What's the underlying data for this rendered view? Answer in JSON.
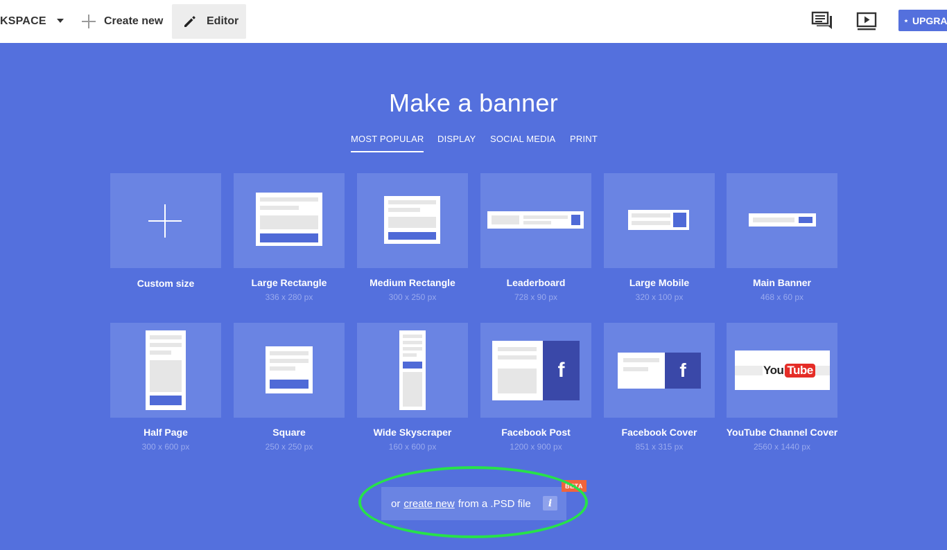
{
  "topbar": {
    "workspace_label": "KSPACE",
    "create_new_label": "Create new",
    "editor_label": "Editor",
    "upgrade_label": "UPGRADE"
  },
  "page": {
    "title": "Make a banner",
    "tabs": [
      {
        "label": "MOST POPULAR",
        "active": true
      },
      {
        "label": "DISPLAY",
        "active": false
      },
      {
        "label": "SOCIAL MEDIA",
        "active": false
      },
      {
        "label": "PRINT",
        "active": false
      }
    ]
  },
  "formats": [
    {
      "name": "Custom size",
      "size": ""
    },
    {
      "name": "Large Rectangle",
      "size": "336 x 280 px"
    },
    {
      "name": "Medium Rectangle",
      "size": "300 x 250 px"
    },
    {
      "name": "Leaderboard",
      "size": "728 x 90 px"
    },
    {
      "name": "Large Mobile",
      "size": "320 x 100 px"
    },
    {
      "name": "Main Banner",
      "size": "468 x 60 px"
    },
    {
      "name": "Half Page",
      "size": "300 x 600 px"
    },
    {
      "name": "Square",
      "size": "250 x 250 px"
    },
    {
      "name": "Wide Skyscraper",
      "size": "160 x 600 px"
    },
    {
      "name": "Facebook Post",
      "size": "1200 x 900 px"
    },
    {
      "name": "Facebook Cover",
      "size": "851 x 315 px"
    },
    {
      "name": "YouTube Channel Cover",
      "size": "2560 x 1440 px"
    }
  ],
  "psd": {
    "prefix": "or",
    "link": "create new",
    "suffix": "from a .PSD file",
    "info": "i",
    "badge": "BETA"
  },
  "brand": {
    "facebook_letter": "f",
    "youtube_you": "You",
    "youtube_tube": "Tube"
  },
  "colors": {
    "background": "#5470dd",
    "tile": "#6a84e3",
    "facebook": "#3a48a8",
    "highlight": "#27e24a",
    "badge": "#f0643c"
  }
}
